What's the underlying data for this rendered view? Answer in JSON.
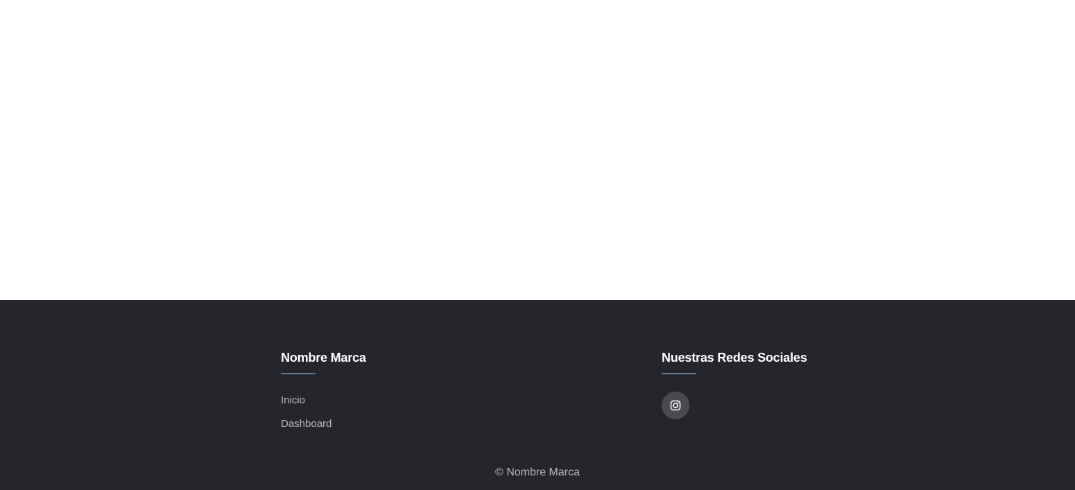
{
  "footer": {
    "brand_column": {
      "heading": "Nombre Marca",
      "links": [
        {
          "label": "Inicio"
        },
        {
          "label": "Dashboard"
        }
      ]
    },
    "social_column": {
      "heading": "Nuestras Redes Sociales",
      "icons": [
        {
          "name": "instagram-icon"
        }
      ]
    },
    "copyright": "© Nombre Marca"
  },
  "colors": {
    "footer_background": "#25262b",
    "heading_text": "#ffffff",
    "link_text": "#b8b9bc",
    "underline_accent": "#5f7f9e",
    "social_button_bg": "#4a4b50"
  }
}
